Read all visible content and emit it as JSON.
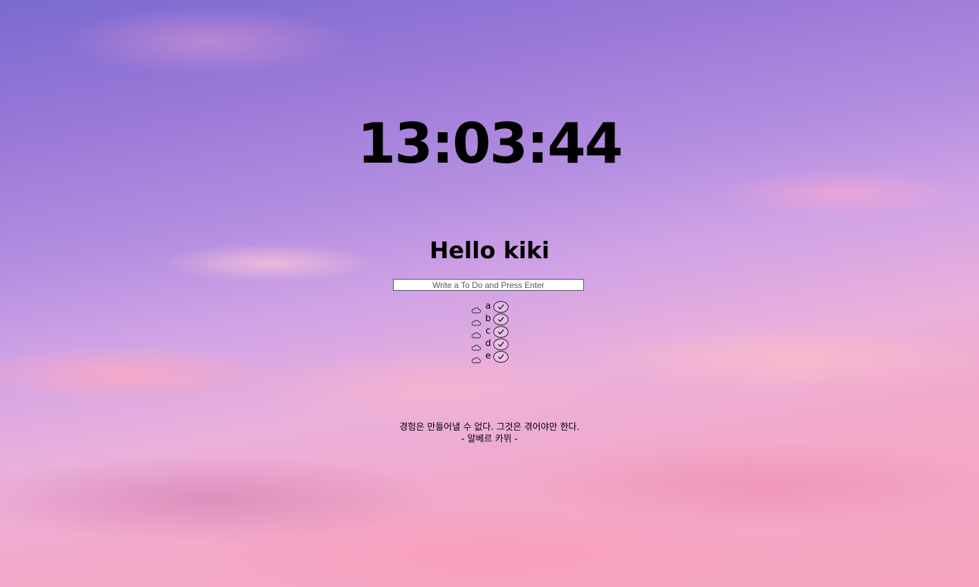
{
  "clock": {
    "time": "13:03:44"
  },
  "greeting": {
    "text": "Hello kiki"
  },
  "todo_form": {
    "placeholder": "Write a To Do and Press Enter"
  },
  "todos": [
    {
      "text": "a",
      "icon": "cloud-icon",
      "button_icon": "check-icon"
    },
    {
      "text": "b",
      "icon": "cloud-icon",
      "button_icon": "check-icon"
    },
    {
      "text": "c",
      "icon": "cloud-icon",
      "button_icon": "check-icon"
    },
    {
      "text": "d",
      "icon": "cloud-icon",
      "button_icon": "check-icon"
    },
    {
      "text": "e",
      "icon": "cloud-icon",
      "button_icon": "check-icon"
    }
  ],
  "quote": {
    "text": "경험은 만들어낼 수 없다. 그것은 겪어야만 한다.",
    "author": "- 알베르 카뮈 -"
  },
  "colors": {
    "text": "#000000",
    "sky_top": "#7a6ad0",
    "sky_bottom": "#f7a5c0"
  }
}
